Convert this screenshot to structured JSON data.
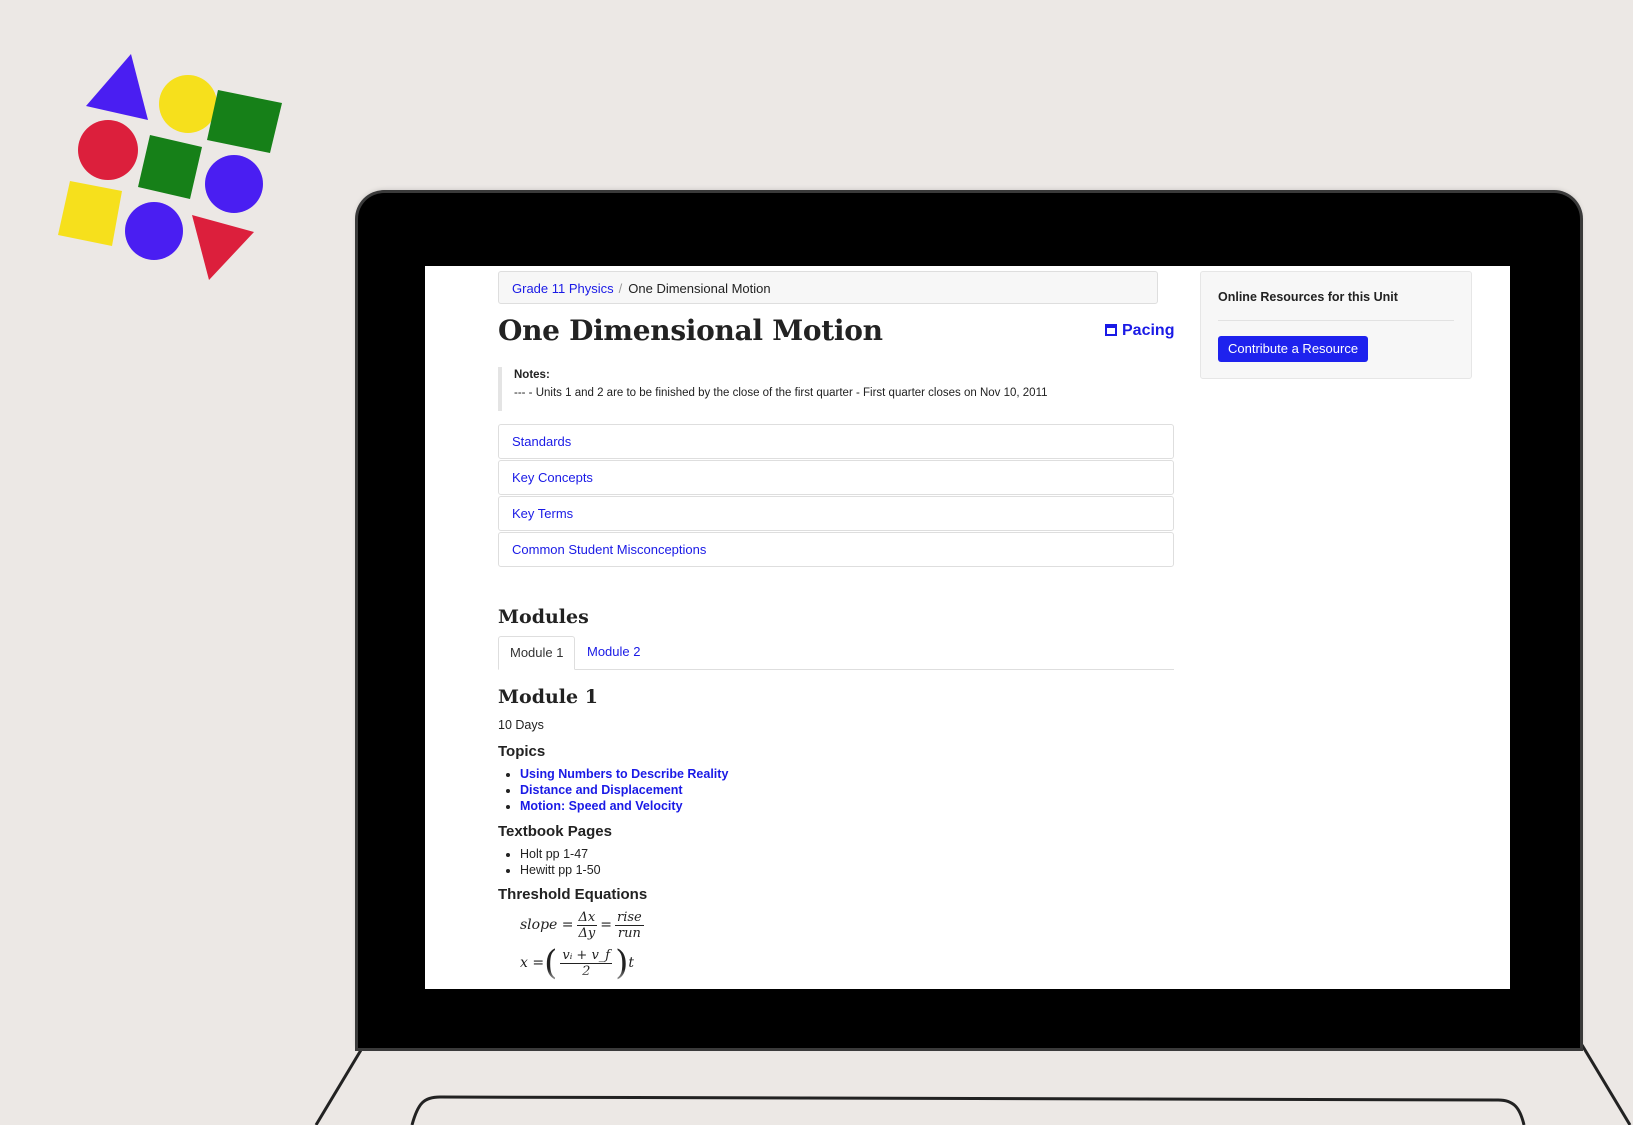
{
  "colors": {
    "background": "#ece8e5",
    "link": "#1a1ae6",
    "button": "#1e22ee",
    "logo_blue": "#4a1ef2",
    "logo_yellow": "#f6e01c",
    "logo_green": "#168018",
    "logo_red": "#dc1f3c"
  },
  "breadcrumb": {
    "parent": "Grade 11 Physics",
    "separator": "/",
    "current": "One Dimensional Motion"
  },
  "page": {
    "title": "One Dimensional Motion",
    "pacing_label": "Pacing",
    "pacing_icon": "calendar-icon"
  },
  "notes": {
    "label": "Notes:",
    "text": "--- - Units 1 and 2 are to be finished by the close of the first quarter - First quarter closes on Nov 10, 2011"
  },
  "accordion": [
    {
      "label": "Standards"
    },
    {
      "label": "Key Concepts"
    },
    {
      "label": "Key Terms"
    },
    {
      "label": "Common Student Misconceptions"
    }
  ],
  "modules": {
    "heading": "Modules",
    "tabs": [
      {
        "label": "Module 1",
        "active": true
      },
      {
        "label": "Module 2",
        "active": false
      }
    ],
    "current": {
      "title": "Module 1",
      "duration": "10 Days",
      "topics_heading": "Topics",
      "topics": [
        "Using Numbers to Describe Reality",
        "Distance and Displacement",
        "Motion: Speed and Velocity"
      ],
      "textbook_heading": "Textbook Pages",
      "textbook_pages": [
        "Holt pp 1-47",
        "Hewitt pp 1-50"
      ],
      "equations_heading": "Threshold Equations",
      "equations": [
        {
          "lhs": "slope =",
          "frac1_num": "Δx",
          "frac1_den": "Δy",
          "eq": "=",
          "frac2_num": "rise",
          "frac2_den": "run"
        },
        {
          "lhs": "x =",
          "frac_num": "vᵢ + v_f",
          "frac_den": "2",
          "tail": "t"
        }
      ]
    }
  },
  "sidebar": {
    "title": "Online Resources for this Unit",
    "button_label": "Contribute a Resource"
  }
}
